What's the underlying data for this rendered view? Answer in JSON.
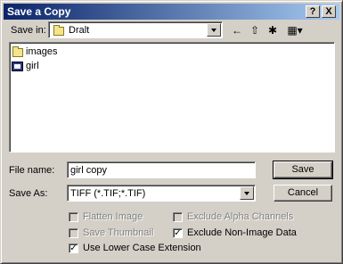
{
  "window": {
    "title": "Save a Copy"
  },
  "titlebar_buttons": {
    "help": "?",
    "close": "X"
  },
  "save_in": {
    "label": "Save in:",
    "value": "Dralt"
  },
  "toolbar": {
    "back": "←",
    "up": "⇧",
    "new_folder": "✱",
    "view": "▦▾"
  },
  "files": [
    {
      "name": "images",
      "icon": "folder-icon"
    },
    {
      "name": "girl",
      "icon": "file-icon"
    }
  ],
  "file_name": {
    "label": "File name:",
    "value": "girl copy"
  },
  "save_as": {
    "label": "Save As:",
    "value": "TIFF (*.TIF;*.TIF)"
  },
  "buttons": {
    "save": "Save",
    "cancel": "Cancel"
  },
  "options": {
    "flatten_image": {
      "label": "Flatten Image",
      "checked": false,
      "enabled": false
    },
    "save_thumbnail": {
      "label": "Save Thumbnail",
      "checked": false,
      "enabled": false
    },
    "use_lower_case": {
      "label": "Use Lower Case Extension",
      "checked": true,
      "enabled": true
    },
    "exclude_alpha": {
      "label": "Exclude Alpha Channels",
      "checked": false,
      "enabled": false
    },
    "exclude_non_image": {
      "label": "Exclude Non-Image Data",
      "checked": true,
      "enabled": true
    }
  }
}
